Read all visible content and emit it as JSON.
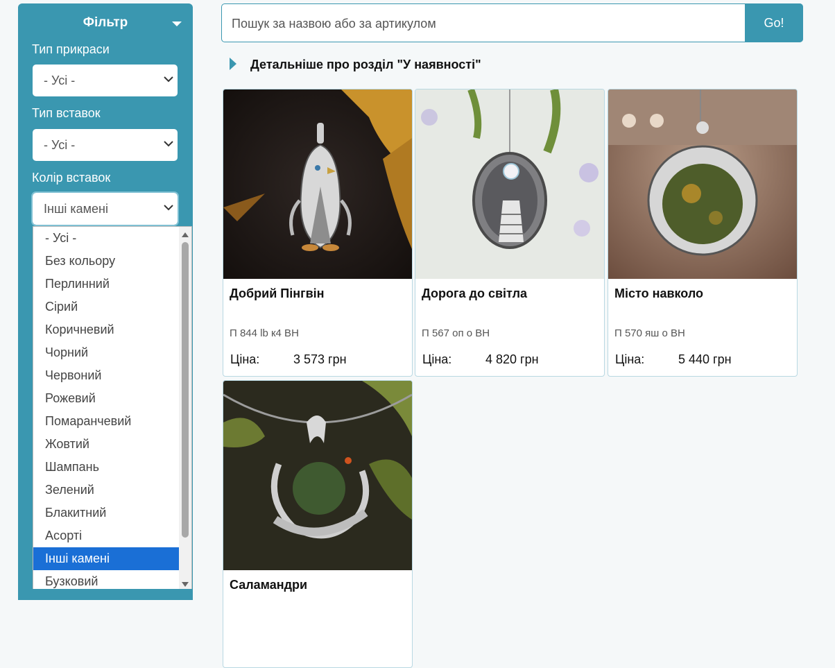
{
  "filter": {
    "title": "Фільтр",
    "jewelry_type": {
      "label": "Тип прикраси",
      "value": "- Усі -"
    },
    "insert_type": {
      "label": "Тип вставок",
      "value": "- Усі -"
    },
    "insert_color": {
      "label": "Колір вставок",
      "value": "Інші камені",
      "options": [
        "- Усі -",
        "Без кольору",
        "Перлинний",
        "Сірий",
        "Коричневий",
        "Чорний",
        "Червоний",
        "Рожевий",
        "Помаранчевий",
        "Жовтий",
        "Шампань",
        "Зелений",
        "Блакитний",
        "Асорті",
        "Інші камені",
        "Бузковий"
      ],
      "selected_index": 14
    }
  },
  "search": {
    "placeholder": "Пошук за назвою або за артикулом",
    "button": "Go!"
  },
  "details_link": "Детальніше про розділ \"У наявності\"",
  "products": [
    {
      "name": "Добрий Пінгвін",
      "sku": "П 844 lb к4 ВН",
      "price_label": "Ціна:",
      "price": "3 573 грн"
    },
    {
      "name": "Дорога до світла",
      "sku": "П 567 оп о ВН",
      "price_label": "Ціна:",
      "price": "4 820 грн"
    },
    {
      "name": "Місто навколо",
      "sku": "П 570 яш о ВН",
      "price_label": "Ціна:",
      "price": "5 440 грн"
    },
    {
      "name": "Саламандри"
    }
  ],
  "colors": {
    "accent": "#3a97b0",
    "selected": "#1a6fd6"
  }
}
